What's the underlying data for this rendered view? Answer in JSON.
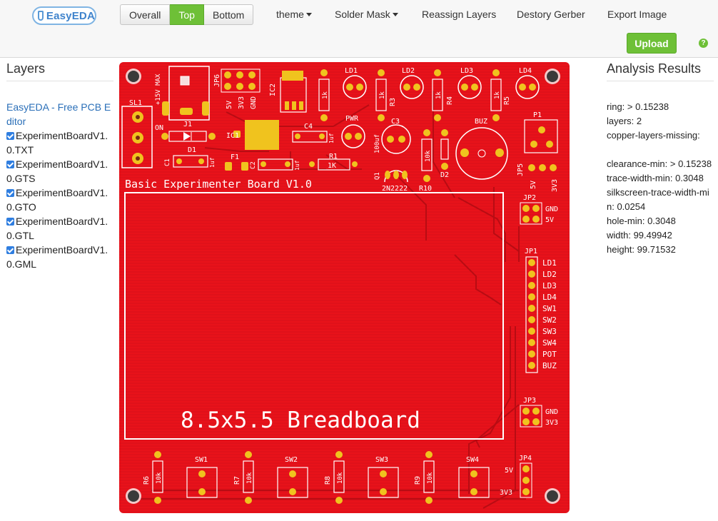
{
  "header": {
    "logo_text": "EasyEDA",
    "view_buttons": [
      {
        "label": "Overall",
        "active": false
      },
      {
        "label": "Top",
        "active": true
      },
      {
        "label": "Bottom",
        "active": false
      }
    ],
    "menu": {
      "theme": "theme",
      "solder_mask": "Solder Mask",
      "reassign_layers": "Reassign Layers",
      "destroy_gerber": "Destory Gerber",
      "export_image": "Export Image"
    },
    "upload_label": "Upload",
    "help_glyph": "?"
  },
  "layers_panel": {
    "title": "Layers",
    "editor_link": "EasyEDA - Free PCB Editor",
    "layers": [
      {
        "name": "ExperimentBoardV1.0.TXT",
        "checked": true
      },
      {
        "name": "ExperimentBoardV1.0.GTS",
        "checked": true
      },
      {
        "name": "ExperimentBoardV1.0.GTO",
        "checked": true
      },
      {
        "name": "ExperimentBoardV1.0.GTL",
        "checked": true
      },
      {
        "name": "ExperimentBoardV1.0.GML",
        "checked": true
      }
    ]
  },
  "analysis_panel": {
    "title": "Analysis Results",
    "results": [
      "ring:  > 0.15238",
      "layers:  2",
      "copper-layers-missing:",
      "",
      "clearance-min:  > 0.15238",
      "trace-width-min:  0.3048",
      "silkscreen-trace-width-min:  0.0254",
      "hole-min:  0.3048",
      "width:  99.49942",
      "height:  99.71532"
    ]
  },
  "board": {
    "title": "Basic Experimenter Board V1.0",
    "breadboard_label": "8.5x5.5 Breadboard",
    "labels": {
      "sl1": "SL1",
      "on": "ON",
      "j1": "J1",
      "d1": "D1",
      "c1": "C1",
      "uf1": "1uf",
      "f1": "F1",
      "ic1": "IC1",
      "c2": "C2",
      "uf2": "1uf",
      "c4": "C4",
      "uf4": "1uf",
      "ic2": "IC2",
      "max": "+15V MAX",
      "jp6": "JP6",
      "p5v": "5V",
      "p3v3": "3V3",
      "pgnd": "GND",
      "r1": "R1",
      "r1v": "1K",
      "r2v": "1k",
      "r3": "R3",
      "r3v": "1k",
      "r4": "R4",
      "r4v": "1k",
      "r5": "R5",
      "r5v": "1k",
      "ld1": "LD1",
      "ld2": "LD2",
      "ld3": "LD3",
      "ld4": "LD4",
      "pwr": "PWR",
      "c3": "C3",
      "c3v": "100uf",
      "q1": "Q1",
      "q1v": "2N2222",
      "r10": "R10",
      "r10v": "10k",
      "d2": "D2",
      "buz": "BUZ",
      "p1": "P1",
      "jp5": "JP5",
      "jp5a": "5V",
      "jp5b": "3V3",
      "jp2": "JP2",
      "jp2a": "GND",
      "jp2b": "5V",
      "jp1": "JP1",
      "jp3": "JP3",
      "jp3a": "GND",
      "jp3b": "3V3",
      "jp4": "JP4",
      "jp4a": "5V",
      "jp4b": "3V3",
      "sw1": "SW1",
      "sw2": "SW2",
      "sw3": "SW3",
      "sw4": "SW4",
      "r6": "R6",
      "r7": "R7",
      "r8": "R8",
      "r9": "R9",
      "r10k": "10k"
    },
    "header_pins": [
      "LD1",
      "LD2",
      "LD3",
      "LD4",
      "SW1",
      "SW2",
      "SW3",
      "SW4",
      "POT",
      "BUZ"
    ],
    "colors": {
      "pcb": "#e8121a",
      "copper": "#f0c31e",
      "silk": "#ffffff",
      "trace": "#c40d14"
    }
  }
}
